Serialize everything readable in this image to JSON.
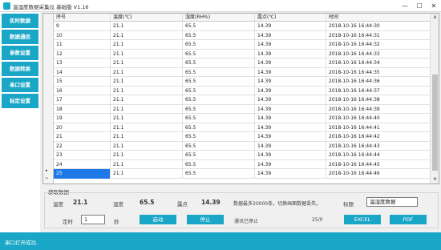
{
  "window": {
    "title": "温湿度数据采集仪 基础版 V1.16",
    "min_label": "—",
    "max_label": "☐",
    "close_label": "✕"
  },
  "sidebar": {
    "items": [
      {
        "label": "实时数据"
      },
      {
        "label": "数据通信"
      },
      {
        "label": "参数设置"
      },
      {
        "label": "数据转换"
      },
      {
        "label": "串口设置"
      },
      {
        "label": "标定设置"
      }
    ]
  },
  "grid": {
    "columns": [
      "序号",
      "温度(℃)",
      "湿度(RH%)",
      "露点(℃)",
      "时间"
    ],
    "current_row_marker": "▸",
    "new_row_marker": "*",
    "rows": [
      [
        "9",
        "21.1",
        "65.5",
        "14.39",
        "2018-10-16 16:44:30"
      ],
      [
        "10",
        "21.1",
        "65.5",
        "14.39",
        "2018-10-16 16:44:31"
      ],
      [
        "11",
        "21.1",
        "65.5",
        "14.39",
        "2018-10-16 16:44:32"
      ],
      [
        "12",
        "21.1",
        "65.5",
        "14.39",
        "2018-10-16 16:44:33"
      ],
      [
        "13",
        "21.1",
        "65.5",
        "14.39",
        "2018-10-16 16:44:34"
      ],
      [
        "14",
        "21.1",
        "65.5",
        "14.39",
        "2018-10-16 16:44:35"
      ],
      [
        "15",
        "21.1",
        "65.5",
        "14.39",
        "2018-10-16 16:44:36"
      ],
      [
        "16",
        "21.1",
        "65.5",
        "14.39",
        "2018-10-16 16:44:37"
      ],
      [
        "17",
        "21.1",
        "65.5",
        "14.39",
        "2018-10-16 16:44:38"
      ],
      [
        "18",
        "21.1",
        "65.5",
        "14.39",
        "2018-10-16 16:44:39"
      ],
      [
        "19",
        "21.1",
        "65.5",
        "14.39",
        "2018-10-16 16:44:40"
      ],
      [
        "20",
        "21.1",
        "65.5",
        "14.39",
        "2018-10-16 16:44:41"
      ],
      [
        "21",
        "21.1",
        "65.5",
        "14.39",
        "2018-10-16 16:44:42"
      ],
      [
        "22",
        "21.1",
        "65.5",
        "14.39",
        "2018-10-16 16:44:43"
      ],
      [
        "23",
        "21.1",
        "65.5",
        "14.39",
        "2018-10-16 16:44:44"
      ],
      [
        "24",
        "21.1",
        "65.5",
        "14.39",
        "2018-10-16 16:44:45"
      ],
      [
        "25",
        "21.1",
        "65.5",
        "14.39",
        "2018-10-16 16:44:46"
      ]
    ]
  },
  "panel": {
    "title": "获取数据",
    "temp_label": "温度",
    "temp_value": "21.1",
    "hum_label": "湿度",
    "hum_value": "65.5",
    "dew_label": "露点",
    "dew_value": "14.39",
    "notice": "数据最多20000条，切换画面数据丢失。",
    "title_label": "标题",
    "title_value": "温湿度数据",
    "interval_label": "定时",
    "interval_value": "1",
    "interval_unit": "秒",
    "start_button": "启动",
    "stop_button": "停止",
    "comm_status": "通讯已停止",
    "count": "25/0",
    "excel_button": "EXCEL",
    "pdf_button": "PDF"
  },
  "statusbar": {
    "message": "串口打开成功."
  },
  "colors": {
    "accent": "#1aa6c6",
    "selection": "#1e78e6"
  }
}
